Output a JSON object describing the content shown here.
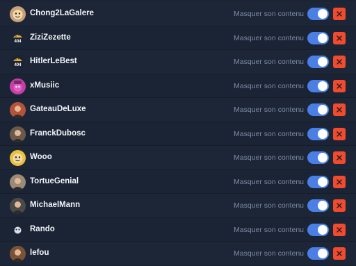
{
  "mask_label": "Masquer son contenu",
  "colors": {
    "toggle_on": "#4a7fe6",
    "remove_button": "#f04a2f",
    "row_text": "#f2f4f8",
    "mask_text": "#7c8aa6"
  },
  "users": [
    {
      "name": "Chong2LaGalere",
      "avatar": "cartoon-face-icon",
      "avatar_color": "#c9a07a",
      "mask_enabled": true
    },
    {
      "name": "ZiziZezette",
      "avatar": "404-cookie-icon",
      "avatar_color": "#1b2434",
      "avatar_text": "404",
      "mask_enabled": true
    },
    {
      "name": "HitlerLeBest",
      "avatar": "404-cookie-icon",
      "avatar_color": "#1b2434",
      "avatar_text": "404",
      "mask_enabled": true
    },
    {
      "name": "xMusiic",
      "avatar": "character-icon",
      "avatar_color": "#c43fa8",
      "mask_enabled": true
    },
    {
      "name": "GateauDeLuxe",
      "avatar": "portrait-icon",
      "avatar_color": "#b5533a",
      "mask_enabled": true
    },
    {
      "name": "FranckDubosc",
      "avatar": "portrait-icon",
      "avatar_color": "#6b5a4a",
      "mask_enabled": true
    },
    {
      "name": "Wooo",
      "avatar": "cartoon-face-icon",
      "avatar_color": "#e9c23a",
      "mask_enabled": true
    },
    {
      "name": "TortueGenial",
      "avatar": "portrait-icon",
      "avatar_color": "#9a8a78",
      "mask_enabled": true
    },
    {
      "name": "MichaelMann",
      "avatar": "portrait-icon",
      "avatar_color": "#4a4a4a",
      "mask_enabled": true
    },
    {
      "name": "Rando",
      "avatar": "ghost-icon",
      "avatar_color": "#1b2434",
      "mask_enabled": true
    },
    {
      "name": "lefou",
      "avatar": "portrait-icon",
      "avatar_color": "#7a5236",
      "mask_enabled": true
    }
  ]
}
